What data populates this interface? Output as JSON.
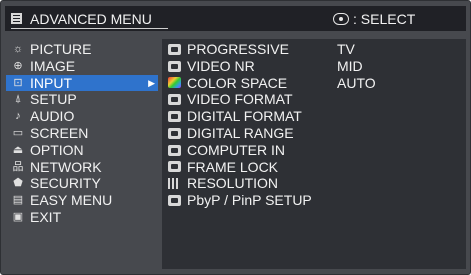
{
  "header": {
    "title": "ADVANCED MENU",
    "select_label": ": SELECT",
    "menu_icon": "menu-list-icon",
    "select_icon": "joystick-icon"
  },
  "sidebar": {
    "items": [
      {
        "label": "PICTURE",
        "icon": "sun-icon",
        "glyph": "☼",
        "active": false
      },
      {
        "label": "IMAGE",
        "icon": "image-icon",
        "glyph": "⊕",
        "active": false
      },
      {
        "label": "INPUT",
        "icon": "input-icon",
        "glyph": "⊡",
        "active": true
      },
      {
        "label": "SETUP",
        "icon": "setup-icon",
        "glyph": "⍋",
        "active": false
      },
      {
        "label": "AUDIO",
        "icon": "music-note-icon",
        "glyph": "♪",
        "active": false
      },
      {
        "label": "SCREEN",
        "icon": "screen-icon",
        "glyph": "▭",
        "active": false
      },
      {
        "label": "OPTION",
        "icon": "option-icon",
        "glyph": "⏏",
        "active": false
      },
      {
        "label": "NETWORK",
        "icon": "network-icon",
        "glyph": "品",
        "active": false
      },
      {
        "label": "SECURITY",
        "icon": "shield-icon",
        "glyph": "⬟",
        "active": false
      },
      {
        "label": "EASY MENU",
        "icon": "easy-menu-icon",
        "glyph": "▤",
        "active": false
      },
      {
        "label": "EXIT",
        "icon": "exit-icon",
        "glyph": "▣",
        "active": false
      }
    ],
    "active_arrow": "▶"
  },
  "submenu": {
    "items": [
      {
        "label": "PROGRESSIVE",
        "value": "TV",
        "icon": "progressive-icon"
      },
      {
        "label": "VIDEO NR",
        "value": "MID",
        "icon": "video-nr-icon"
      },
      {
        "label": "COLOR SPACE",
        "value": "AUTO",
        "icon": "color-space-icon"
      },
      {
        "label": "VIDEO FORMAT",
        "value": "",
        "icon": "video-format-icon"
      },
      {
        "label": "DIGITAL FORMAT",
        "value": "",
        "icon": "digital-format-icon"
      },
      {
        "label": "DIGITAL RANGE",
        "value": "",
        "icon": "digital-range-icon"
      },
      {
        "label": "COMPUTER IN",
        "value": "",
        "icon": "computer-in-icon"
      },
      {
        "label": "FRAME LOCK",
        "value": "",
        "icon": "frame-lock-icon"
      },
      {
        "label": "RESOLUTION",
        "value": "",
        "icon": "resolution-icon"
      },
      {
        "label": "PbyP / PinP SETUP",
        "value": "",
        "icon": "pbyp-pinp-icon"
      }
    ]
  },
  "colors": {
    "osd_bg": "#47494e",
    "header_bg": "#202126",
    "panel_bg": "#2e3035",
    "highlight": "#2f73cc",
    "text": "#f2f2f2"
  }
}
